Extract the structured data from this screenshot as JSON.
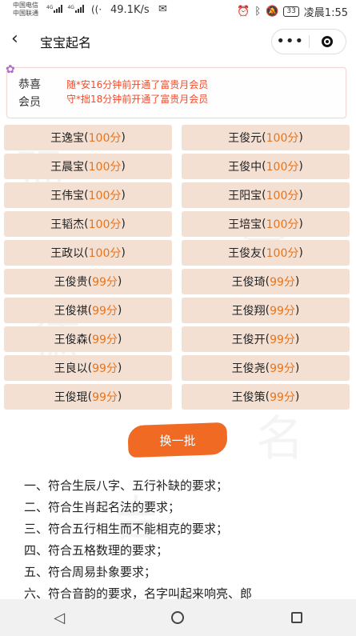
{
  "status_bar": {
    "carrier1": "中国电信",
    "carrier2": "中国联通",
    "net1": "4G",
    "net2": "4G",
    "speed": "49.1K/s",
    "battery": "33",
    "time": "凌晨1:55"
  },
  "nav": {
    "back_icon": "chevron-left-icon",
    "title": "宝宝起名"
  },
  "notice": {
    "label": "恭喜会员",
    "lines": [
      "随*安16分钟前开通了富贵月会员",
      "守*拙18分钟前开通了富贵月会员"
    ]
  },
  "names": [
    {
      "name": "王逸宝",
      "score": "100分"
    },
    {
      "name": "王俊元",
      "score": "100分"
    },
    {
      "name": "王晨宝",
      "score": "100分"
    },
    {
      "name": "王俊中",
      "score": "100分"
    },
    {
      "name": "王伟宝",
      "score": "100分"
    },
    {
      "name": "王阳宝",
      "score": "100分"
    },
    {
      "name": "王韬杰",
      "score": "100分"
    },
    {
      "name": "王培宝",
      "score": "100分"
    },
    {
      "name": "王政以",
      "score": "100分"
    },
    {
      "name": "王俊友",
      "score": "100分"
    },
    {
      "name": "王俊贵",
      "score": "99分"
    },
    {
      "name": "王俊琦",
      "score": "99分"
    },
    {
      "name": "王俊祺",
      "score": "99分"
    },
    {
      "name": "王俊翔",
      "score": "99分"
    },
    {
      "name": "王俊森",
      "score": "99分"
    },
    {
      "name": "王俊开",
      "score": "99分"
    },
    {
      "name": "王良以",
      "score": "99分"
    },
    {
      "name": "王俊尧",
      "score": "99分"
    },
    {
      "name": "王俊琨",
      "score": "99分"
    },
    {
      "name": "王俊策",
      "score": "99分"
    }
  ],
  "swap_button": "换一批",
  "requirements": [
    "一、符合生辰八字、五行补缺的要求；",
    "二、符合生肖起名法的要求；",
    "三、符合五行相生而不能相克的要求；",
    "四、符合五格数理的要求；",
    "五、符合周易卦象要求；",
    "六、符合音韵的要求，名字叫起来响亮、郎"
  ],
  "colors": {
    "accent": "#f06a24",
    "score": "#e8741c",
    "notice_text": "#ee4c2c",
    "cell_bg": "#f3e0d3"
  }
}
